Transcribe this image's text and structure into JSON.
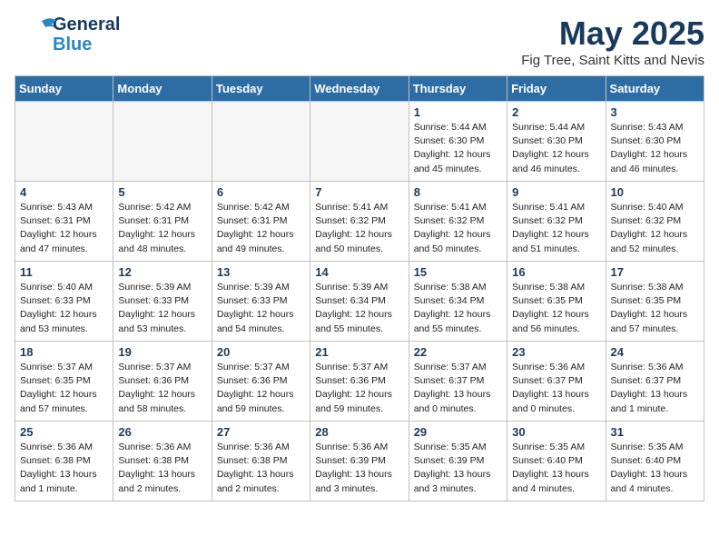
{
  "header": {
    "logo_general": "General",
    "logo_blue": "Blue",
    "month_title": "May 2025",
    "subtitle": "Fig Tree, Saint Kitts and Nevis"
  },
  "weekdays": [
    "Sunday",
    "Monday",
    "Tuesday",
    "Wednesday",
    "Thursday",
    "Friday",
    "Saturday"
  ],
  "weeks": [
    [
      {
        "day": "",
        "info": "",
        "empty": true
      },
      {
        "day": "",
        "info": "",
        "empty": true
      },
      {
        "day": "",
        "info": "",
        "empty": true
      },
      {
        "day": "",
        "info": "",
        "empty": true
      },
      {
        "day": "1",
        "info": "Sunrise: 5:44 AM\nSunset: 6:30 PM\nDaylight: 12 hours\nand 45 minutes.",
        "empty": false
      },
      {
        "day": "2",
        "info": "Sunrise: 5:44 AM\nSunset: 6:30 PM\nDaylight: 12 hours\nand 46 minutes.",
        "empty": false
      },
      {
        "day": "3",
        "info": "Sunrise: 5:43 AM\nSunset: 6:30 PM\nDaylight: 12 hours\nand 46 minutes.",
        "empty": false
      }
    ],
    [
      {
        "day": "4",
        "info": "Sunrise: 5:43 AM\nSunset: 6:31 PM\nDaylight: 12 hours\nand 47 minutes.",
        "empty": false
      },
      {
        "day": "5",
        "info": "Sunrise: 5:42 AM\nSunset: 6:31 PM\nDaylight: 12 hours\nand 48 minutes.",
        "empty": false
      },
      {
        "day": "6",
        "info": "Sunrise: 5:42 AM\nSunset: 6:31 PM\nDaylight: 12 hours\nand 49 minutes.",
        "empty": false
      },
      {
        "day": "7",
        "info": "Sunrise: 5:41 AM\nSunset: 6:32 PM\nDaylight: 12 hours\nand 50 minutes.",
        "empty": false
      },
      {
        "day": "8",
        "info": "Sunrise: 5:41 AM\nSunset: 6:32 PM\nDaylight: 12 hours\nand 50 minutes.",
        "empty": false
      },
      {
        "day": "9",
        "info": "Sunrise: 5:41 AM\nSunset: 6:32 PM\nDaylight: 12 hours\nand 51 minutes.",
        "empty": false
      },
      {
        "day": "10",
        "info": "Sunrise: 5:40 AM\nSunset: 6:32 PM\nDaylight: 12 hours\nand 52 minutes.",
        "empty": false
      }
    ],
    [
      {
        "day": "11",
        "info": "Sunrise: 5:40 AM\nSunset: 6:33 PM\nDaylight: 12 hours\nand 53 minutes.",
        "empty": false
      },
      {
        "day": "12",
        "info": "Sunrise: 5:39 AM\nSunset: 6:33 PM\nDaylight: 12 hours\nand 53 minutes.",
        "empty": false
      },
      {
        "day": "13",
        "info": "Sunrise: 5:39 AM\nSunset: 6:33 PM\nDaylight: 12 hours\nand 54 minutes.",
        "empty": false
      },
      {
        "day": "14",
        "info": "Sunrise: 5:39 AM\nSunset: 6:34 PM\nDaylight: 12 hours\nand 55 minutes.",
        "empty": false
      },
      {
        "day": "15",
        "info": "Sunrise: 5:38 AM\nSunset: 6:34 PM\nDaylight: 12 hours\nand 55 minutes.",
        "empty": false
      },
      {
        "day": "16",
        "info": "Sunrise: 5:38 AM\nSunset: 6:35 PM\nDaylight: 12 hours\nand 56 minutes.",
        "empty": false
      },
      {
        "day": "17",
        "info": "Sunrise: 5:38 AM\nSunset: 6:35 PM\nDaylight: 12 hours\nand 57 minutes.",
        "empty": false
      }
    ],
    [
      {
        "day": "18",
        "info": "Sunrise: 5:37 AM\nSunset: 6:35 PM\nDaylight: 12 hours\nand 57 minutes.",
        "empty": false
      },
      {
        "day": "19",
        "info": "Sunrise: 5:37 AM\nSunset: 6:36 PM\nDaylight: 12 hours\nand 58 minutes.",
        "empty": false
      },
      {
        "day": "20",
        "info": "Sunrise: 5:37 AM\nSunset: 6:36 PM\nDaylight: 12 hours\nand 59 minutes.",
        "empty": false
      },
      {
        "day": "21",
        "info": "Sunrise: 5:37 AM\nSunset: 6:36 PM\nDaylight: 12 hours\nand 59 minutes.",
        "empty": false
      },
      {
        "day": "22",
        "info": "Sunrise: 5:37 AM\nSunset: 6:37 PM\nDaylight: 13 hours\nand 0 minutes.",
        "empty": false
      },
      {
        "day": "23",
        "info": "Sunrise: 5:36 AM\nSunset: 6:37 PM\nDaylight: 13 hours\nand 0 minutes.",
        "empty": false
      },
      {
        "day": "24",
        "info": "Sunrise: 5:36 AM\nSunset: 6:37 PM\nDaylight: 13 hours\nand 1 minute.",
        "empty": false
      }
    ],
    [
      {
        "day": "25",
        "info": "Sunrise: 5:36 AM\nSunset: 6:38 PM\nDaylight: 13 hours\nand 1 minute.",
        "empty": false
      },
      {
        "day": "26",
        "info": "Sunrise: 5:36 AM\nSunset: 6:38 PM\nDaylight: 13 hours\nand 2 minutes.",
        "empty": false
      },
      {
        "day": "27",
        "info": "Sunrise: 5:36 AM\nSunset: 6:38 PM\nDaylight: 13 hours\nand 2 minutes.",
        "empty": false
      },
      {
        "day": "28",
        "info": "Sunrise: 5:36 AM\nSunset: 6:39 PM\nDaylight: 13 hours\nand 3 minutes.",
        "empty": false
      },
      {
        "day": "29",
        "info": "Sunrise: 5:35 AM\nSunset: 6:39 PM\nDaylight: 13 hours\nand 3 minutes.",
        "empty": false
      },
      {
        "day": "30",
        "info": "Sunrise: 5:35 AM\nSunset: 6:40 PM\nDaylight: 13 hours\nand 4 minutes.",
        "empty": false
      },
      {
        "day": "31",
        "info": "Sunrise: 5:35 AM\nSunset: 6:40 PM\nDaylight: 13 hours\nand 4 minutes.",
        "empty": false
      }
    ]
  ]
}
